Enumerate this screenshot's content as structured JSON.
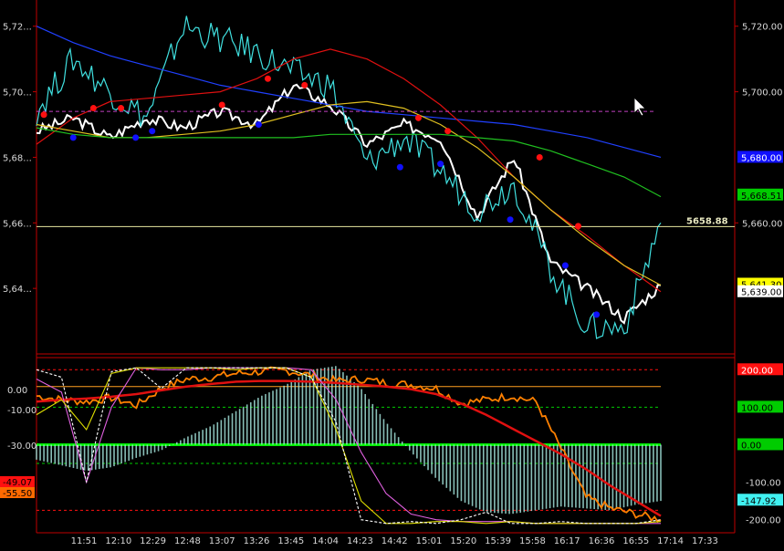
{
  "chart_data": [
    {
      "type": "line",
      "panel": "price",
      "x": [
        "11:51",
        "12:10",
        "12:29",
        "12:48",
        "13:07",
        "13:26",
        "13:45",
        "14:04",
        "14:23",
        "14:42",
        "15:01",
        "15:20",
        "15:39",
        "15:58",
        "16:17",
        "16:36",
        "16:55"
      ],
      "y_left_ticks": [
        "5,72...",
        "5,70...",
        "5,68...",
        "5,66...",
        "5,64..."
      ],
      "y_left_values": [
        5720,
        5700,
        5680,
        5660,
        5640
      ],
      "y_right_ticks": [
        "5,720.00",
        "5,700.00",
        "5,660.00"
      ],
      "y_right_values": [
        5720,
        5700,
        5660
      ],
      "ylim": [
        5620,
        5728
      ],
      "grid": false,
      "price_label": "5658.88",
      "price_value": 5658.88,
      "price_line_color": "#e8e8a0",
      "resistance_value": 5694,
      "resistance_color": "#c040c0",
      "badges": [
        {
          "text": "5,680.00",
          "value": 5680,
          "bg": "#1010ff",
          "fg": "#ffffff"
        },
        {
          "text": "5,668.51",
          "value": 5668.5,
          "bg": "#00cc00",
          "fg": "#000000"
        },
        {
          "text": "5,641.30",
          "value": 5641.3,
          "bg": "#ffff00",
          "fg": "#000000"
        },
        {
          "text": "5,639.00",
          "value": 5639,
          "bg": "#ffffff",
          "fg": "#000000"
        }
      ],
      "series": [
        {
          "key": "close",
          "color": "#ffffff",
          "values": [
            5688,
            5692,
            5686,
            5692,
            5689,
            5694,
            5690,
            5702,
            5696,
            5684,
            5690,
            5686,
            5662,
            5680,
            5648,
            5640,
            5631,
            5641
          ]
        },
        {
          "key": "high_low",
          "color": "#40e0e0",
          "values": [
            5694,
            5710,
            5700,
            5692,
            5720,
            5716,
            5712,
            5706,
            5702,
            5678,
            5686,
            5676,
            5664,
            5672,
            5646,
            5628,
            5628,
            5660
          ]
        },
        {
          "key": "ma_blue",
          "color": "#2040ff",
          "values": [
            5720,
            5715,
            5711,
            5708,
            5705,
            5702,
            5700,
            5698,
            5696,
            5694,
            5693,
            5692,
            5691,
            5690,
            5688,
            5686,
            5683,
            5680
          ]
        },
        {
          "key": "ma_red",
          "color": "#e01010",
          "values": [
            5684,
            5692,
            5697,
            5698,
            5699,
            5700,
            5704,
            5710,
            5713,
            5710,
            5704,
            5696,
            5686,
            5674,
            5664,
            5656,
            5647,
            5639
          ]
        },
        {
          "key": "ma_yellow",
          "color": "#e0c020",
          "values": [
            5690,
            5688,
            5686,
            5686,
            5687,
            5688,
            5690,
            5693,
            5696,
            5697,
            5695,
            5690,
            5683,
            5674,
            5664,
            5655,
            5647,
            5641
          ]
        },
        {
          "key": "ma_green",
          "color": "#20c020",
          "values": [
            5689,
            5687,
            5686,
            5686,
            5686,
            5686,
            5686,
            5686,
            5687,
            5687,
            5687,
            5687,
            5686,
            5685,
            5682,
            5678,
            5674,
            5668
          ]
        }
      ],
      "red_dots": [
        [
          0.2,
          5693
        ],
        [
          1.55,
          5695
        ],
        [
          2.3,
          5695
        ],
        [
          5.05,
          5696
        ],
        [
          6.3,
          5704
        ],
        [
          7.3,
          5702
        ],
        [
          10.4,
          5692
        ],
        [
          11.2,
          5688
        ],
        [
          13.7,
          5680
        ],
        [
          14.75,
          5659
        ]
      ],
      "blue_dots": [
        [
          1.0,
          5686
        ],
        [
          2.7,
          5686
        ],
        [
          3.15,
          5688
        ],
        [
          6.05,
          5690
        ],
        [
          9.9,
          5677
        ],
        [
          11.0,
          5678
        ],
        [
          12.9,
          5661
        ],
        [
          14.4,
          5647
        ],
        [
          15.25,
          5632
        ]
      ],
      "dot_colors": {
        "red": "#ff1010",
        "blue": "#1010ff"
      }
    },
    {
      "type": "line",
      "panel": "oscillator",
      "left_ticks": [
        "0.00",
        "-10.00",
        "-30.00"
      ],
      "left_values": [
        0,
        -10,
        -30
      ],
      "right_ticks": [
        "-100.00",
        "-200.00"
      ],
      "right_values": [
        -100,
        -200
      ],
      "right_badges": [
        {
          "text": "200.00",
          "value": 200,
          "bg": "#ff1010",
          "fg": "#ffffff"
        },
        {
          "text": "100.00",
          "value": 100,
          "bg": "#00cc00",
          "fg": "#000000"
        },
        {
          "text": "0.00",
          "value": 0,
          "bg": "#00cc00",
          "fg": "#000000"
        },
        {
          "text": "-147.92",
          "value": -147.92,
          "bg": "#40f0f0",
          "fg": "#000000"
        }
      ],
      "left_badges": [
        {
          "text": "-49.07",
          "value": -49.07,
          "bg": "#ff1010",
          "fg": "#000000"
        },
        {
          "text": "-55.50",
          "value": -55.5,
          "bg": "#ff6a00",
          "fg": "#000000"
        }
      ],
      "ref_lines": [
        {
          "value": 200,
          "color": "#ff1010",
          "dash": true
        },
        {
          "value": 100,
          "color": "#00cc00",
          "dash": true
        },
        {
          "value": 0,
          "color": "#00ee00",
          "dash": false,
          "width": 3
        },
        {
          "value": 155,
          "color": "#ffa020",
          "dash": false
        },
        {
          "value": -50,
          "color": "#00cc00",
          "dash": true
        },
        {
          "value": -175,
          "color": "#ff1010",
          "dash": true
        }
      ],
      "ylim": [
        -230,
        225
      ],
      "histogram_color": "#a0e0d8",
      "histogram": [
        -40,
        -55,
        -70,
        -60,
        -35,
        -15,
        20,
        50,
        90,
        130,
        160,
        200,
        210,
        150,
        60,
        -20,
        -90,
        -150,
        -180,
        -185,
        -175,
        -165,
        -170,
        -175,
        -160,
        -150
      ],
      "series": [
        {
          "key": "orange_osc",
          "color": "#ff8000",
          "values": [
            130,
            120,
            115,
            125,
            105,
            150,
            175,
            180,
            190,
            195,
            198,
            185,
            170,
            175,
            165,
            160,
            150,
            110,
            120,
            130,
            115,
            -10,
            -140,
            -170,
            -185,
            -200
          ]
        },
        {
          "key": "red_smooth",
          "color": "#e01010",
          "values": [
            115,
            120,
            123,
            128,
            135,
            145,
            155,
            162,
            168,
            170,
            170,
            168,
            165,
            160,
            155,
            148,
            135,
            110,
            80,
            45,
            10,
            -25,
            -65,
            -110,
            -150,
            -190
          ]
        },
        {
          "key": "magenta",
          "color": "#e060e0",
          "values": [
            175,
            140,
            -100,
            100,
            205,
            200,
            200,
            205,
            205,
            205,
            205,
            200,
            120,
            -20,
            -130,
            -185,
            -200,
            -205,
            -205,
            -205,
            -210,
            -210,
            -210,
            -210,
            -210,
            -210
          ]
        },
        {
          "key": "yellow_thin",
          "color": "#e0e000",
          "values": [
            80,
            120,
            40,
            190,
            205,
            205,
            205,
            205,
            200,
            205,
            205,
            180,
            40,
            -150,
            -210,
            -210,
            -205,
            -205,
            -210,
            -205,
            -210,
            -210,
            -210,
            -210,
            -210,
            -205
          ]
        },
        {
          "key": "white_dashed",
          "color": "#ffffff",
          "values": [
            200,
            180,
            -100,
            195,
            205,
            150,
            205,
            205,
            205,
            205,
            205,
            180,
            60,
            -200,
            -210,
            -205,
            -210,
            -200,
            -180,
            -210,
            -210,
            -205,
            -210,
            -210,
            -210,
            -200
          ]
        }
      ]
    }
  ],
  "time_axis": [
    "11:51",
    "12:10",
    "12:29",
    "12:48",
    "13:07",
    "13:26",
    "13:45",
    "14:04",
    "14:23",
    "14:42",
    "15:01",
    "15:20",
    "15:39",
    "15:58",
    "16:17",
    "16:36",
    "16:55",
    "17:14",
    "17:33"
  ]
}
